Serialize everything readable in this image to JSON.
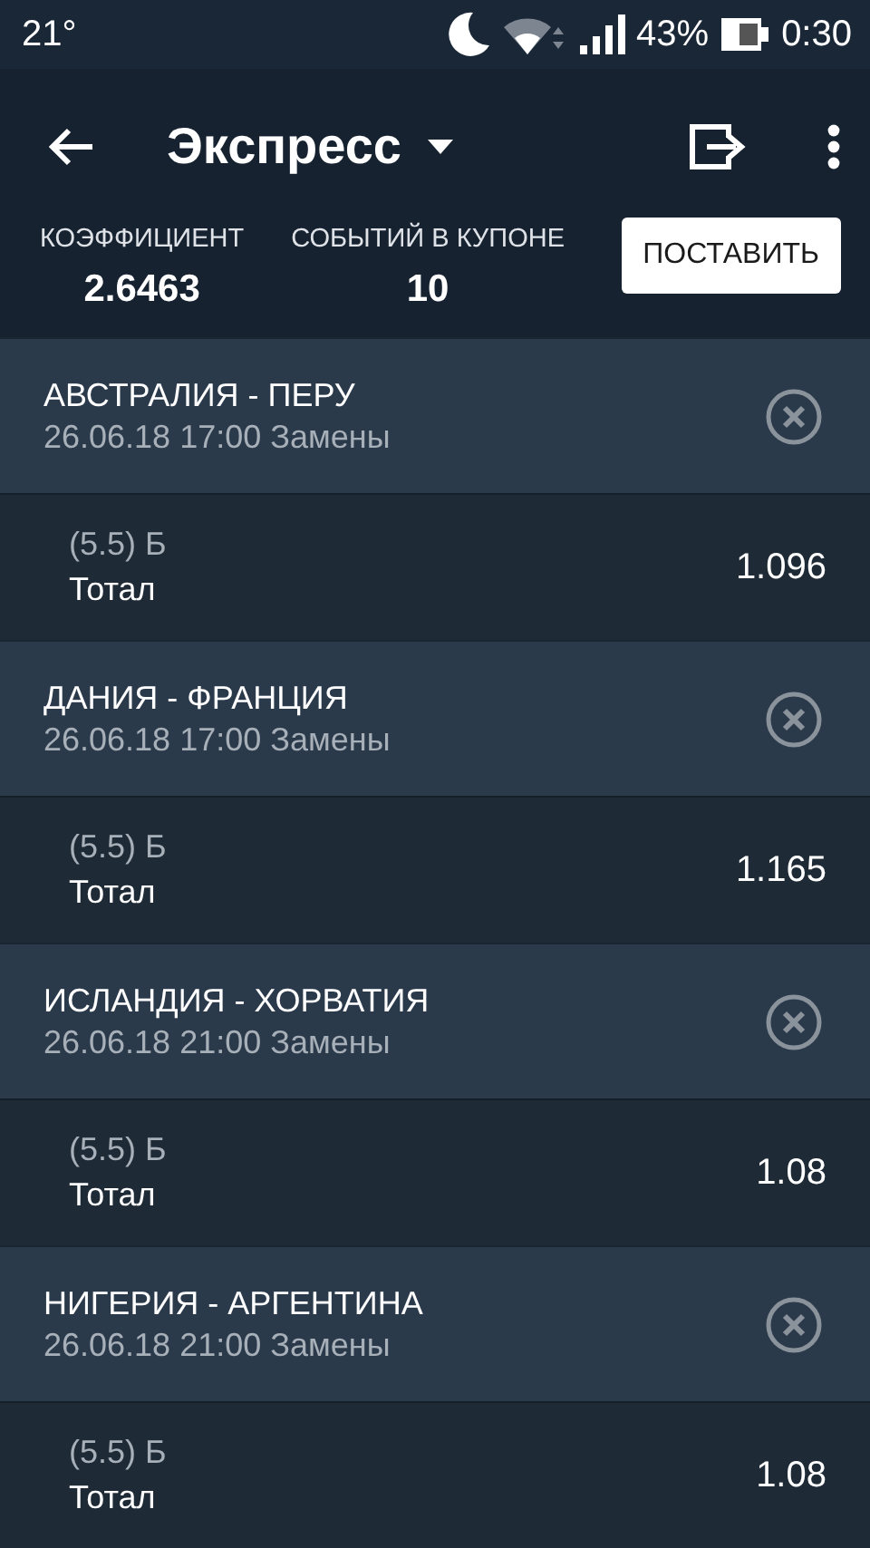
{
  "status_bar": {
    "temperature": "21°",
    "battery_percent": "43%",
    "time": "0:30"
  },
  "toolbar": {
    "title": "Экспресс"
  },
  "summary": {
    "odds_label": "КОЭФФИЦИЕНТ",
    "odds_value": "2.6463",
    "events_label": "СОБЫТИЙ В КУПОНЕ",
    "events_value": "10",
    "place_button": "ПОСТАВИТЬ"
  },
  "events": [
    {
      "match": "АВСТРАЛИЯ - ПЕРУ",
      "info": "26.06.18 17:00 Замены",
      "bet": "(5.5) Б",
      "market": "Тотал",
      "odds": "1.096"
    },
    {
      "match": "ДАНИЯ - ФРАНЦИЯ",
      "info": "26.06.18 17:00 Замены",
      "bet": "(5.5) Б",
      "market": "Тотал",
      "odds": "1.165"
    },
    {
      "match": "ИСЛАНДИЯ - ХОРВАТИЯ",
      "info": "26.06.18 21:00 Замены",
      "bet": "(5.5) Б",
      "market": "Тотал",
      "odds": "1.08"
    },
    {
      "match": "НИГЕРИЯ - АРГЕНТИНА",
      "info": "26.06.18 21:00 Замены",
      "bet": "(5.5) Б",
      "market": "Тотал",
      "odds": "1.08"
    }
  ]
}
